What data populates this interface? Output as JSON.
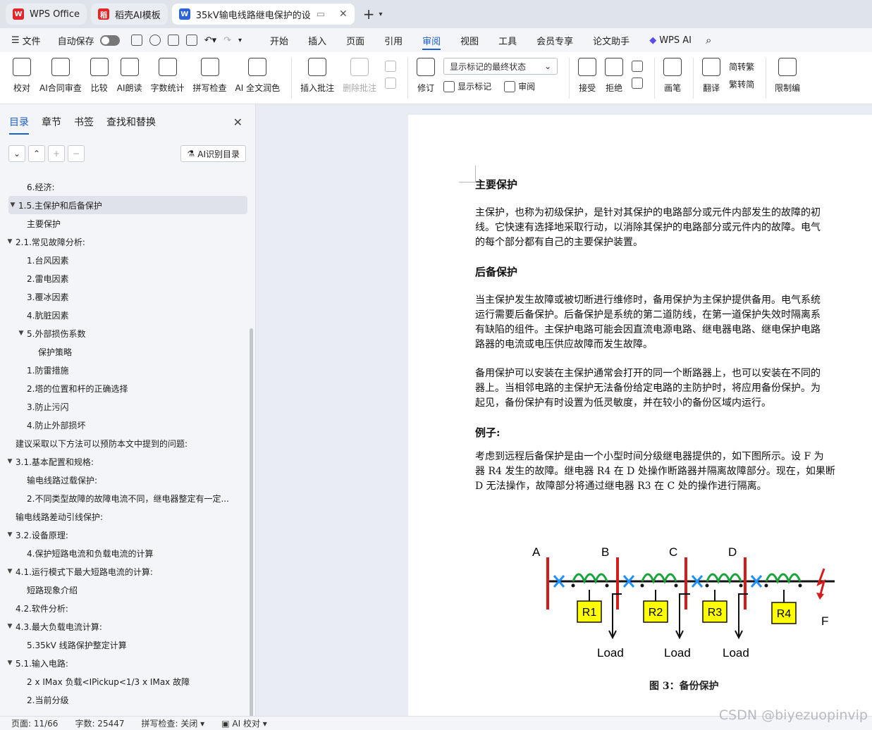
{
  "tabs": [
    {
      "label": "WPS Office",
      "icon": "wps-logo-icon"
    },
    {
      "label": "稻壳AI模板",
      "icon": "docer-logo-icon"
    },
    {
      "label": "35kV输电线路继电保护的设",
      "icon": "word-doc-icon"
    }
  ],
  "menubar": {
    "file": "文件",
    "autosave": "自动保存",
    "tabs": [
      "开始",
      "插入",
      "页面",
      "引用",
      "审阅",
      "视图",
      "工具",
      "会员专享",
      "论文助手",
      "WPS AI"
    ]
  },
  "ribbon": {
    "proofread": "校对",
    "contract_review": "AI合同审查",
    "compare": "比较",
    "ai_read": "AI朗读",
    "word_count": "字数统计",
    "spell_check": "拼写检查",
    "ai_polish": "AI 全文润色",
    "insert_comment": "插入批注",
    "delete_comment": "删除批注",
    "track_changes": "修订",
    "markup_state": "显示标记的最终状态",
    "show_markup": "显示标记",
    "review": "审阅",
    "accept": "接受",
    "reject": "拒绝",
    "pen": "画笔",
    "translate": "翻译",
    "to_traditional": "简转繁",
    "to_simplified": "繁转简",
    "restrict_edit": "限制编"
  },
  "sidebar": {
    "tabs": [
      "目录",
      "章节",
      "书签",
      "查找和替换"
    ],
    "ai_toc": "AI识别目录",
    "toc": [
      {
        "text": "6.经济:",
        "level": 2,
        "arrow": ""
      },
      {
        "text": "1.5.主保护和后备保护",
        "level": 1,
        "arrow": "▼",
        "selected": true
      },
      {
        "text": "主要保护",
        "level": 2,
        "arrow": ""
      },
      {
        "text": "2.1.常见故障分析:",
        "level": 1,
        "arrow": "▼"
      },
      {
        "text": "1.台风因素",
        "level": 2,
        "arrow": ""
      },
      {
        "text": "2.雷电因素",
        "level": 2,
        "arrow": ""
      },
      {
        "text": "3.覆冰因素",
        "level": 2,
        "arrow": ""
      },
      {
        "text": "4.肮脏因素",
        "level": 2,
        "arrow": ""
      },
      {
        "text": "5.外部损伤系数",
        "level": 2,
        "arrow": "▼"
      },
      {
        "text": "保护策略",
        "level": 3,
        "arrow": ""
      },
      {
        "text": "1.防雷措施",
        "level": 2,
        "arrow": ""
      },
      {
        "text": "2.塔的位置和杆的正确选择",
        "level": 2,
        "arrow": ""
      },
      {
        "text": "3.防止污闪",
        "level": 2,
        "arrow": ""
      },
      {
        "text": "4.防止外部损坏",
        "level": 2,
        "arrow": ""
      },
      {
        "text": "建议采取以下方法可以预防本文中提到的问题:",
        "level": 1,
        "arrow": ""
      },
      {
        "text": "3.1.基本配置和规格:",
        "level": 1,
        "arrow": "▼"
      },
      {
        "text": "输电线路过载保护:",
        "level": 2,
        "arrow": ""
      },
      {
        "text": "2.不同类型故障的故障电流不同，继电器整定有一定...",
        "level": 2,
        "arrow": ""
      },
      {
        "text": "输电线路差动引线保护:",
        "level": 1,
        "arrow": ""
      },
      {
        "text": "3.2.设备原理:",
        "level": 1,
        "arrow": "▼"
      },
      {
        "text": "4.保护短路电流和负载电流的计算",
        "level": 2,
        "arrow": ""
      },
      {
        "text": "4.1.运行模式下最大短路电流的计算:",
        "level": 1,
        "arrow": "▼"
      },
      {
        "text": "短路现象介绍",
        "level": 2,
        "arrow": ""
      },
      {
        "text": "4.2.软件分析:",
        "level": 1,
        "arrow": ""
      },
      {
        "text": "4.3.最大负载电流计算:",
        "level": 1,
        "arrow": "▼"
      },
      {
        "text": "5.35kV 线路保护整定计算",
        "level": 2,
        "arrow": ""
      },
      {
        "text": "5.1.输入电路:",
        "level": 1,
        "arrow": "▼"
      },
      {
        "text": "2 x IMax 负载<IPickup<1/3 x IMax 故障",
        "level": 2,
        "arrow": ""
      },
      {
        "text": "2.当前分级",
        "level": 2,
        "arrow": ""
      }
    ]
  },
  "document": {
    "h1": "主要保护",
    "p1": [
      "主保护，也称为初级保护，是针对其保护的电路部分或元件内部发生的故障的初",
      "线。它快速有选择地采取行动，以消除其保护的电路部分或元件内的故障。电气",
      "的每个部分都有自己的主要保护装置。"
    ],
    "h2": "后备保护",
    "p2": [
      "当主保护发生故障或被切断进行维修时，备用保护为主保护提供备用。电气系统",
      "运行需要后备保护。后备保护是系统的第二道防线，在第一道保护失效时隔离系",
      "有缺陷的组件。主保护电路可能会因直流电源电路、继电器电路、继电保护电路",
      "路器的电流或电压供应故障而发生故障。"
    ],
    "p3": [
      "备用保护可以安装在主保护通常会打开的同一个断路器上，也可以安装在不同的",
      "器上。当相邻电路的主保护无法备份给定电路的主防护时，将应用备份保护。为",
      "起见，备份保护有时设置为低灵敏度，并在较小的备份区域内运行。"
    ],
    "h3": "例子:",
    "p4": [
      "考虑到远程后备保护是由一个小型时间分级继电器提供的，如下图所示。设 F 为",
      "器 R4 发生的故障。继电器 R4 在 D 处操作断路器并隔离故障部分。现在，如果断",
      "D 无法操作，故障部分将通过继电器 R3 在 C 处的操作进行隔离。"
    ],
    "figure": {
      "buses": [
        "A",
        "B",
        "C",
        "D"
      ],
      "relays": [
        "R1",
        "R2",
        "R3",
        "R4"
      ],
      "load": "Load",
      "fault": "F"
    },
    "caption": "图 3：备份保护"
  },
  "statusbar": {
    "page": "页面: 11/66",
    "words": "字数: 25447",
    "spell": "拼写检查: 关闭",
    "ai_proof": "AI 校对"
  },
  "watermark": "CSDN @biyezuopinvip",
  "colors": {
    "accent": "#1a5fd6",
    "relay_fill": "#ffff00",
    "bus_red": "#d41c1c",
    "breaker_blue": "#1e90ff",
    "coil_green": "#1aa33a"
  }
}
